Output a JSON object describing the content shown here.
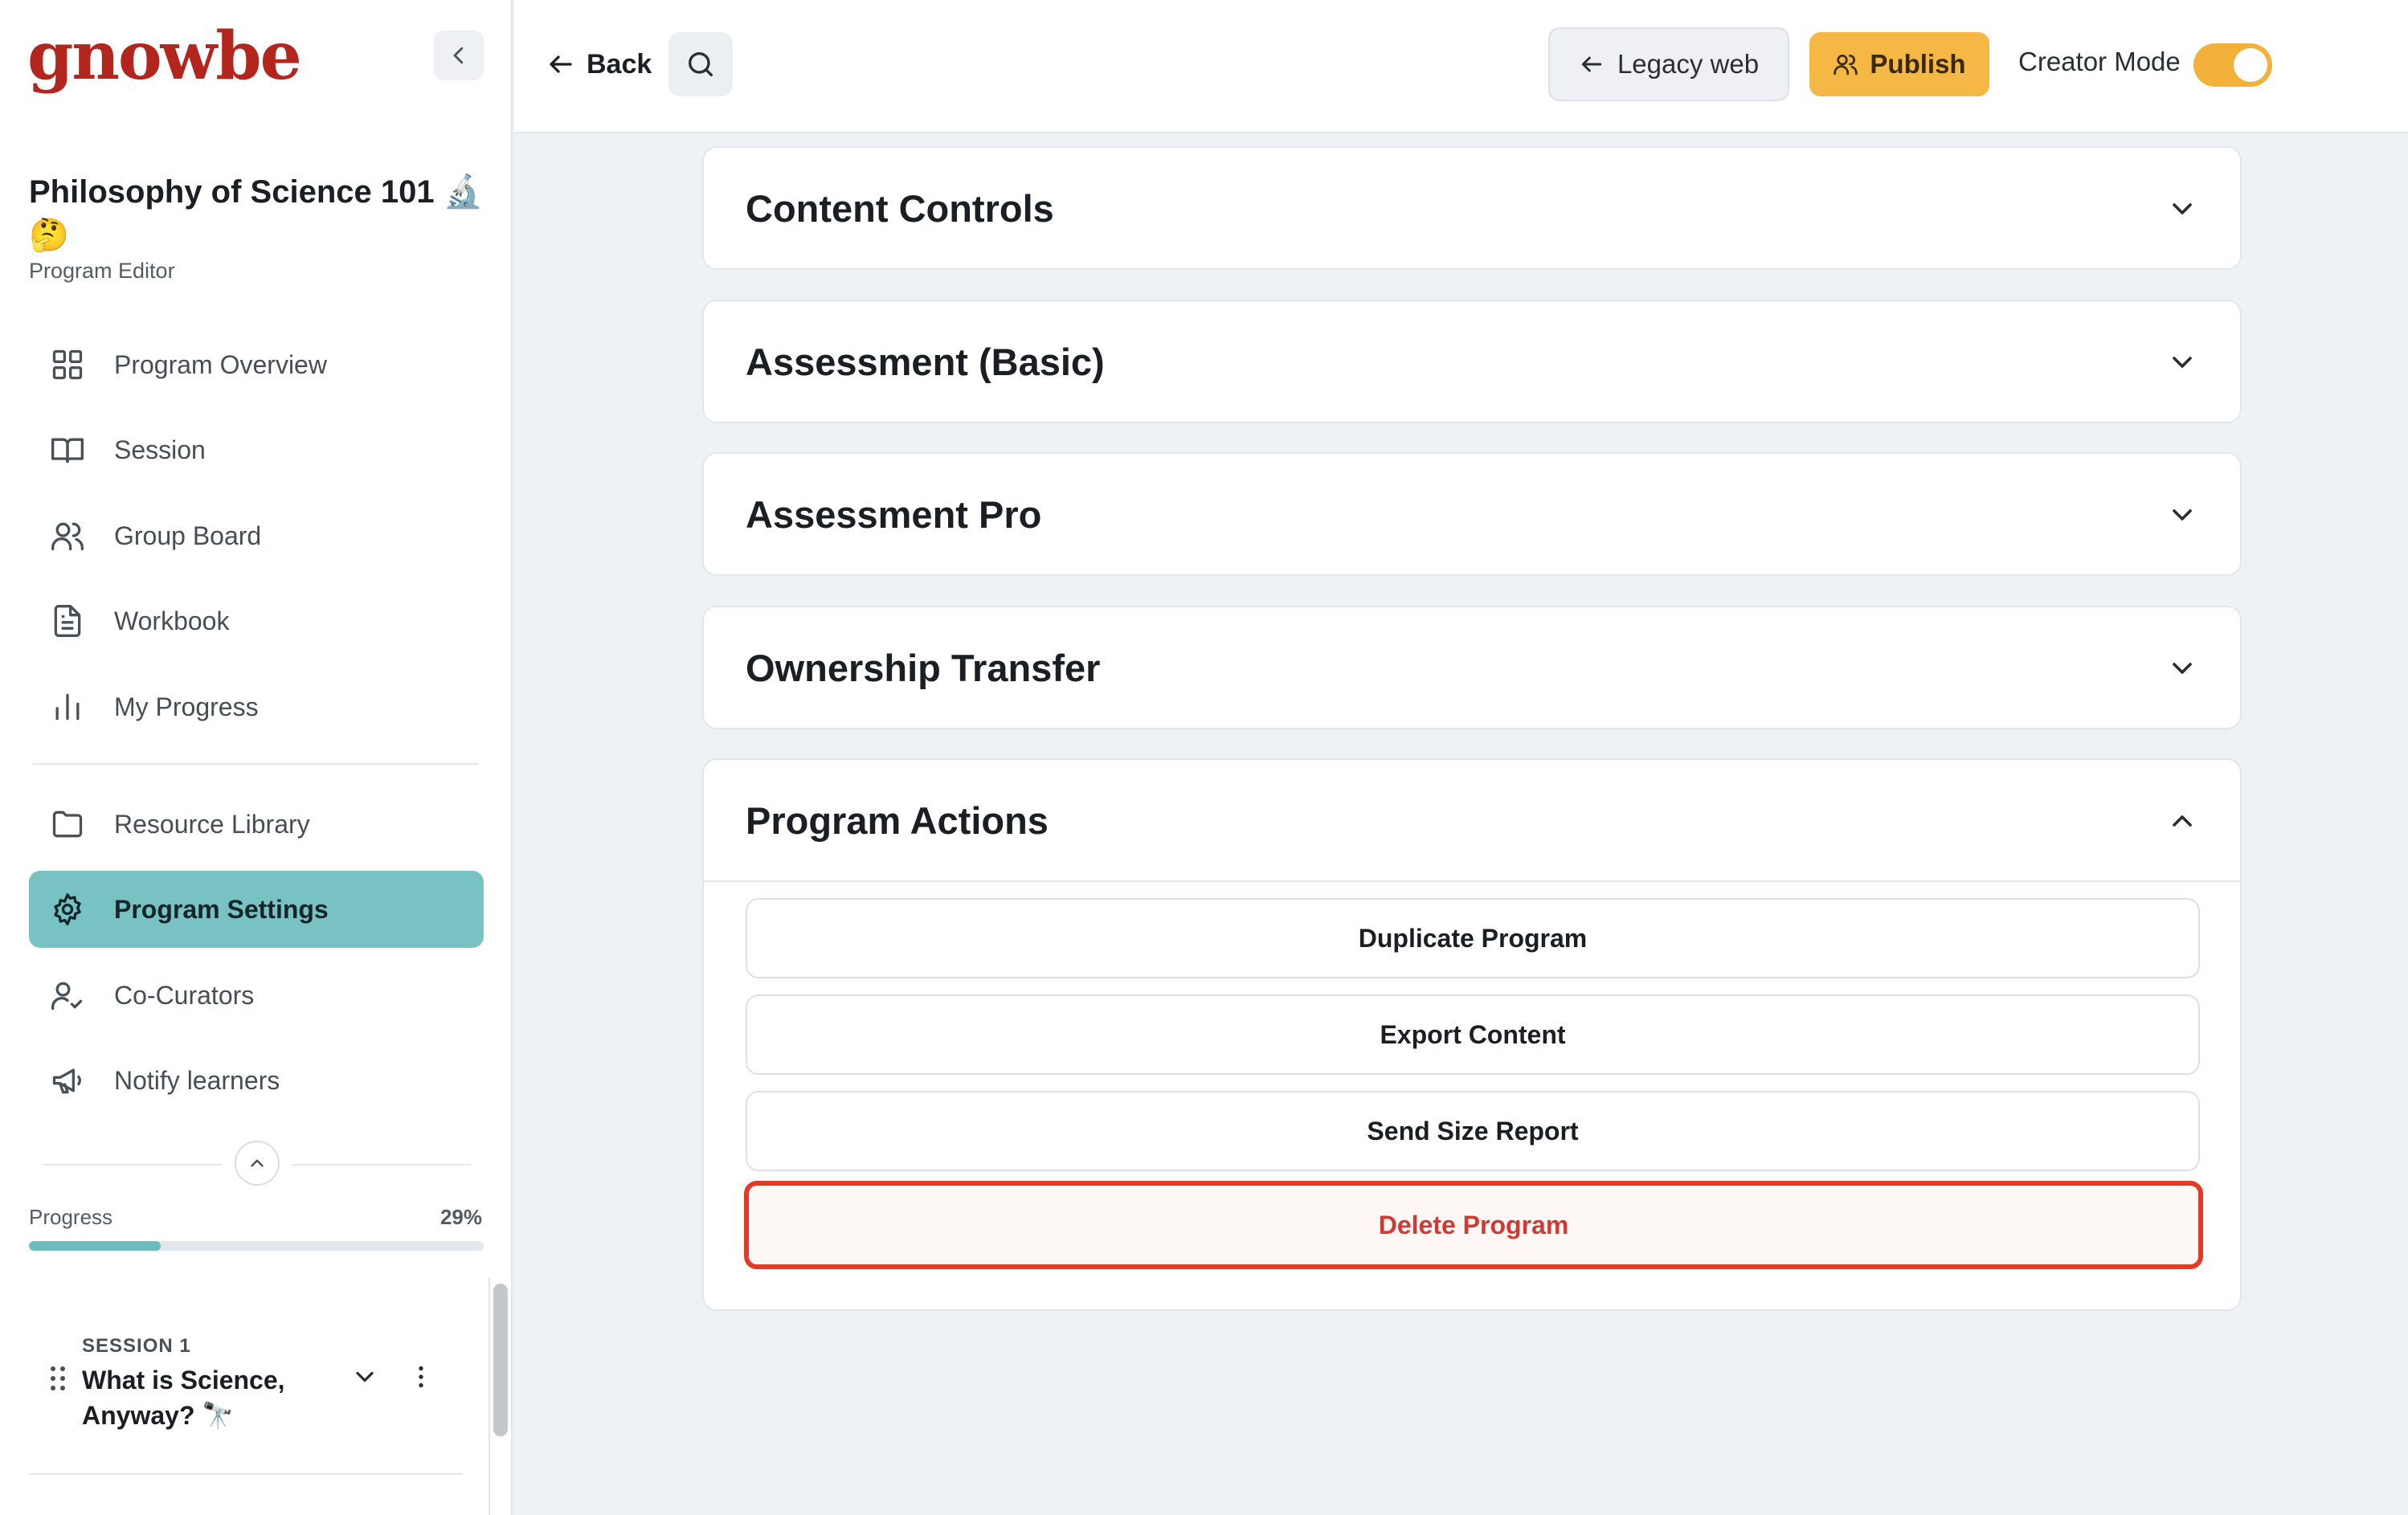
{
  "sidebar": {
    "logo": "gnowbe",
    "program_title": "Philosophy of Science 101 🔬 🤔",
    "program_subtitle": "Program Editor",
    "nav_primary": [
      {
        "label": "Program Overview",
        "icon": "grid-icon"
      },
      {
        "label": "Session",
        "icon": "book-icon"
      },
      {
        "label": "Group Board",
        "icon": "users-icon"
      },
      {
        "label": "Workbook",
        "icon": "document-icon"
      },
      {
        "label": "My Progress",
        "icon": "bar-chart-icon"
      }
    ],
    "nav_secondary": [
      {
        "label": "Resource Library",
        "icon": "folder-icon"
      },
      {
        "label": "Program Settings",
        "icon": "gear-icon",
        "active": true
      },
      {
        "label": "Co-Curators",
        "icon": "user-check-icon"
      },
      {
        "label": "Notify learners",
        "icon": "megaphone-icon"
      }
    ],
    "progress": {
      "label": "Progress",
      "value_text": "29%",
      "fraction": 0.29
    },
    "session": {
      "kicker": "SESSION 1",
      "title": "What is Science, Anyway? 🔭"
    }
  },
  "topbar": {
    "back_label": "Back",
    "legacy_label": "Legacy web",
    "publish_label": "Publish",
    "creator_mode_label": "Creator Mode",
    "creator_mode_on": true
  },
  "panels": [
    {
      "title": "Content Controls",
      "expanded": false
    },
    {
      "title": "Assessment (Basic)",
      "expanded": false
    },
    {
      "title": "Assessment Pro",
      "expanded": false
    },
    {
      "title": "Ownership Transfer",
      "expanded": false
    },
    {
      "title": "Program Actions",
      "expanded": true
    }
  ],
  "program_actions": {
    "duplicate": "Duplicate Program",
    "export": "Export Content",
    "size_report": "Send Size Report",
    "delete": "Delete Program"
  },
  "colors": {
    "brand": "#b3261e",
    "active_nav": "#78c2c4",
    "publish": "#f6b845",
    "toggle": "#f2b13b",
    "danger": "#e23a24"
  }
}
